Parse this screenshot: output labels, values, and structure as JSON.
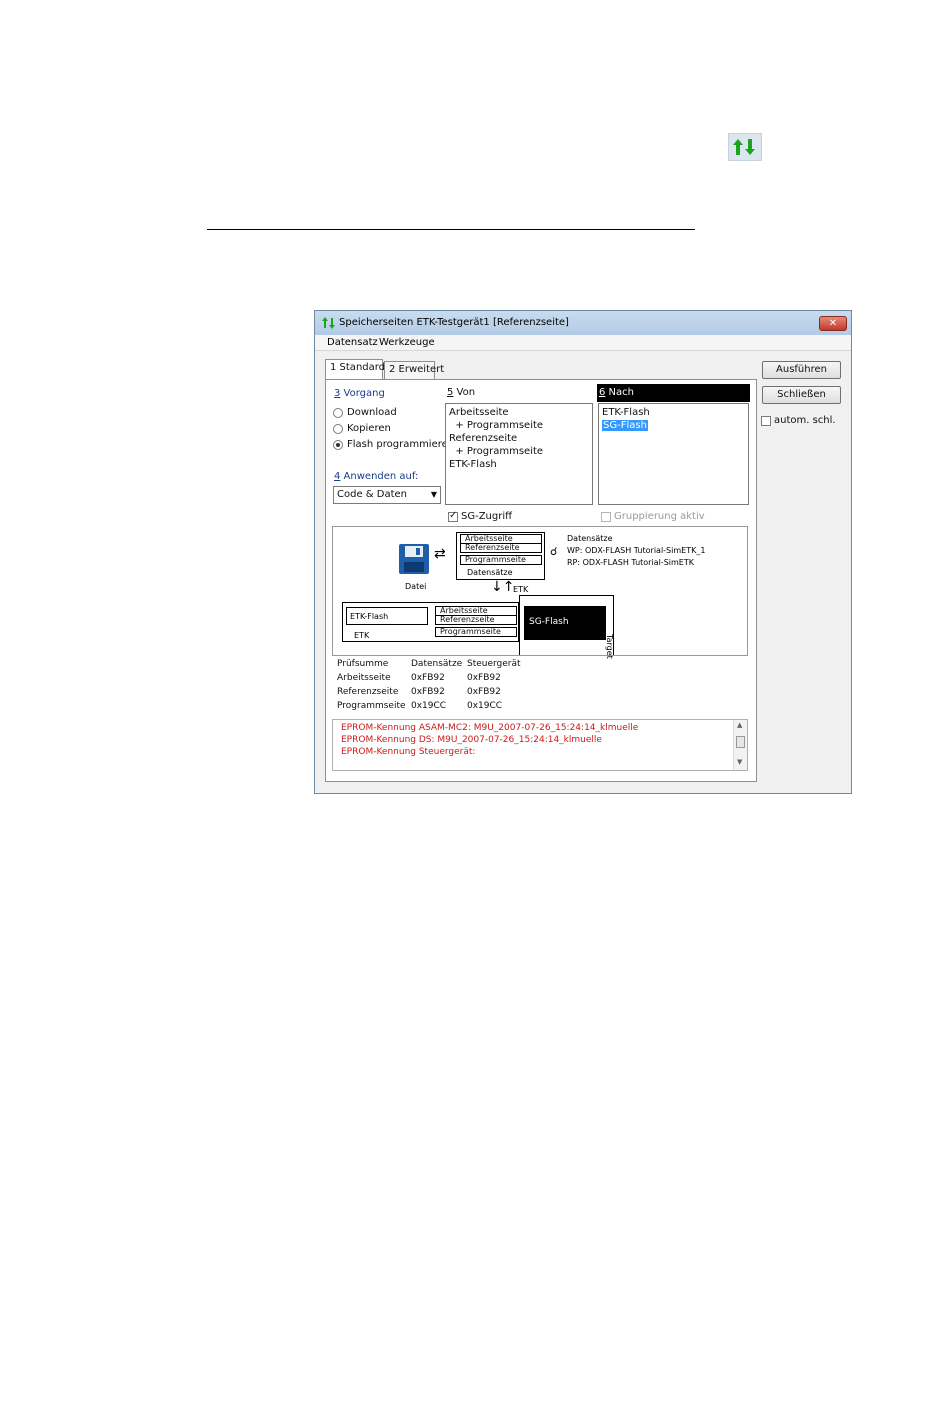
{
  "window": {
    "title": "Speicherseiten ETK-Testgerät1 [Referenzseite]",
    "close_label": "✕"
  },
  "menu": [
    "Datensatz",
    "Werkzeuge"
  ],
  "tabs": [
    "1 Standard",
    "2 Erweitert"
  ],
  "vorgang": {
    "label_num": "3",
    "label_text": " Vorgang",
    "options": [
      {
        "label": "Download",
        "checked": false
      },
      {
        "label": "Kopieren",
        "checked": false
      },
      {
        "label": "Flash programmieren",
        "checked": true
      }
    ]
  },
  "anwenden": {
    "label_num": "4",
    "label_text": " Anwenden auf:",
    "value": "Code & Daten"
  },
  "von": {
    "label_num": "5",
    "label_text": " Von",
    "items": [
      "Arbeitsseite",
      "  + Programmseite",
      "Referenzseite",
      "  + Programmseite",
      "ETK-Flash"
    ]
  },
  "nach": {
    "label_num": "6",
    "label_text": " Nach",
    "items": [
      "ETK-Flash",
      "SG-Flash"
    ],
    "selected": "SG-Flash"
  },
  "checkboxes": {
    "sg_zugriff": "SG-Zugriff",
    "gruppierung": "Gruppierung aktiv",
    "autom": "autom. schl."
  },
  "buttons": {
    "ausfuehren": "Ausführen",
    "schliessen": "Schließen"
  },
  "diagram": {
    "datei": "Datei",
    "pc_pages": [
      "Arbeitsseite",
      "Referenzseite",
      "Programmseite"
    ],
    "datensaetze_box": "Datensätze",
    "datensaetze_title": "Datensätze",
    "wp": "WP: ODX-FLASH Tutorial-SimETK_1",
    "rp": "RP: ODX-FLASH Tutorial-SimETK",
    "etk_arrow": "ETK",
    "etk_flash": "ETK-Flash",
    "etk": "ETK",
    "etk_pages": [
      "Arbeitsseite",
      "Referenzseite",
      "Programmseite"
    ],
    "sg_flash": "SG-Flash",
    "target": "Target"
  },
  "checksum": {
    "headers": [
      "Prüfsumme",
      "Datensätze",
      "Steuergerät"
    ],
    "rows": [
      [
        "Arbeitsseite",
        "0xFB92",
        "0xFB92"
      ],
      [
        "Referenzseite",
        "0xFB92",
        "0xFB92"
      ],
      [
        "Programmseite",
        "0x19CC",
        "0x19CC"
      ]
    ]
  },
  "log": [
    "EPROM-Kennung ASAM-MC2:  M9U_2007-07-26_15:24:14_klmuelle",
    "EPROM-Kennung DS:   M9U_2007-07-26_15:24:14_klmuelle",
    "EPROM-Kennung Steuergerät:"
  ]
}
